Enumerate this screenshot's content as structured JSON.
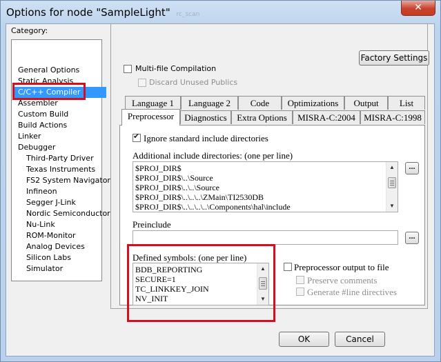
{
  "window": {
    "title": "Options for node \"SampleLight\"",
    "title_suffix": "rc_scan",
    "close_glyph": "✕"
  },
  "category": {
    "label": "Category:",
    "items": [
      {
        "label": "General Options",
        "indent": 0,
        "selected": false
      },
      {
        "label": "Static Analysis",
        "indent": 0,
        "selected": false
      },
      {
        "label": "C/C++ Compiler",
        "indent": 0,
        "selected": true
      },
      {
        "label": "Assembler",
        "indent": 0,
        "selected": false
      },
      {
        "label": "Custom Build",
        "indent": 0,
        "selected": false
      },
      {
        "label": "Build Actions",
        "indent": 0,
        "selected": false
      },
      {
        "label": "Linker",
        "indent": 0,
        "selected": false
      },
      {
        "label": "Debugger",
        "indent": 0,
        "selected": false
      },
      {
        "label": "Third-Party Driver",
        "indent": 1,
        "selected": false
      },
      {
        "label": "Texas Instruments",
        "indent": 1,
        "selected": false
      },
      {
        "label": "FS2 System Navigator",
        "indent": 1,
        "selected": false
      },
      {
        "label": "Infineon",
        "indent": 1,
        "selected": false
      },
      {
        "label": "Segger J-Link",
        "indent": 1,
        "selected": false
      },
      {
        "label": "Nordic Semiconductor",
        "indent": 1,
        "selected": false
      },
      {
        "label": "Nu-Link",
        "indent": 1,
        "selected": false
      },
      {
        "label": "ROM-Monitor",
        "indent": 1,
        "selected": false
      },
      {
        "label": "Analog Devices",
        "indent": 1,
        "selected": false
      },
      {
        "label": "Silicon Labs",
        "indent": 1,
        "selected": false
      },
      {
        "label": "Simulator",
        "indent": 1,
        "selected": false
      }
    ]
  },
  "panel": {
    "factory_settings": "Factory Settings",
    "multi_file": {
      "label": "Multi-file Compilation",
      "checked": false
    },
    "discard_unused": {
      "label": "Discard Unused Publics",
      "checked": false,
      "enabled": false
    }
  },
  "tabs_row1": [
    "Language 1",
    "Language 2",
    "Code",
    "Optimizations",
    "Output",
    "List"
  ],
  "tabs_row2": [
    {
      "label": "Preprocessor",
      "active": true
    },
    {
      "label": "Diagnostics",
      "active": false
    },
    {
      "label": "Extra Options",
      "active": false
    },
    {
      "label": "MISRA-C:2004",
      "active": false
    },
    {
      "label": "MISRA-C:1998",
      "active": false
    }
  ],
  "preprocessor": {
    "ignore_std": {
      "label": "Ignore standard include directories",
      "checked": true
    },
    "include_dirs_label": "Additional include directories: (one per line)",
    "include_dirs": [
      "$PROJ_DIR$",
      "$PROJ_DIR$\\..\\Source",
      "$PROJ_DIR$\\..\\..\\Source",
      "$PROJ_DIR$\\..\\..\\..\\ZMain\\TI2530DB",
      "$PROJ_DIR$\\..\\..\\..\\..\\Components\\hal\\include"
    ],
    "preinclude_label": "Preinclude",
    "preinclude_value": "",
    "defined_symbols_label": "Defined symbols: (one per line)",
    "defined_symbols": [
      "BDB_REPORTING",
      "SECURE=1",
      "TC_LINKKEY_JOIN",
      "NV_INIT"
    ],
    "pp_output": {
      "label": "Preprocessor output to file",
      "checked": false
    },
    "preserve_comments": {
      "label": "Preserve comments",
      "checked": false,
      "enabled": false
    },
    "line_directives": {
      "label": "Generate #line directives",
      "checked": false,
      "enabled": false
    },
    "browse_glyph": "..."
  },
  "buttons": {
    "ok": "OK",
    "cancel": "Cancel"
  },
  "colors": {
    "selection": "#3399ff",
    "highlight_box": "#d01020"
  }
}
